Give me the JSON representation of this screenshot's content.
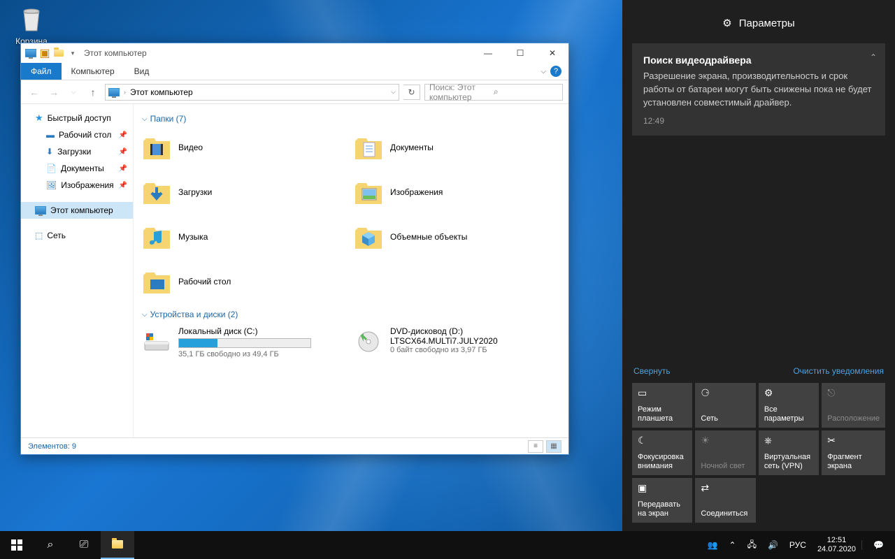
{
  "desktop": {
    "recycle_label": "Корзина"
  },
  "explorer": {
    "title": "Этот компьютер",
    "tabs": {
      "file": "Файл",
      "computer": "Компьютер",
      "view": "Вид"
    },
    "address": {
      "text": "Этот компьютер"
    },
    "search_placeholder": "Поиск: Этот компьютер",
    "sidebar": {
      "quick": "Быстрый доступ",
      "desktop": "Рабочий стол",
      "downloads": "Загрузки",
      "documents": "Документы",
      "pictures": "Изображения",
      "thispc": "Этот компьютер",
      "network": "Сеть"
    },
    "groups": {
      "folders_head": "Папки (7)",
      "drives_head": "Устройства и диски (2)"
    },
    "folders": {
      "video": "Видео",
      "documents": "Документы",
      "downloads": "Загрузки",
      "pictures": "Изображения",
      "music": "Музыка",
      "objects3d": "Объемные объекты",
      "desktop": "Рабочий стол"
    },
    "drives": {
      "c": {
        "name": "Локальный диск (C:)",
        "sub": "35,1 ГБ свободно из 49,4 ГБ",
        "fill_pct": 29
      },
      "d": {
        "name": "DVD-дисковод (D:)",
        "label": "LTSCX64.MULTi7.JULY2020",
        "sub": "0 байт свободно из 3,97 ГБ"
      }
    },
    "status": "Элементов: 9"
  },
  "action_center": {
    "head": "Параметры",
    "notif": {
      "title": "Поиск видеодрайвера",
      "body": "Разрешение экрана, производительность и срок работы от батареи могут быть снижены пока не будет установлен совместимый драйвер.",
      "time": "12:49"
    },
    "collapse": "Свернуть",
    "clear": "Очистить уведомления",
    "tiles": {
      "tablet": "Режим планшета",
      "network": "Сеть",
      "allsettings": "Все параметры",
      "location": "Расположение",
      "focus": "Фокусировка внимания",
      "nightlight": "Ночной свет",
      "vpn": "Виртуальная сеть (VPN)",
      "snip": "Фрагмент экрана",
      "project": "Передавать на экран",
      "connect": "Соединиться"
    }
  },
  "taskbar": {
    "lang": "РУС",
    "time": "12:51",
    "date": "24.07.2020"
  }
}
